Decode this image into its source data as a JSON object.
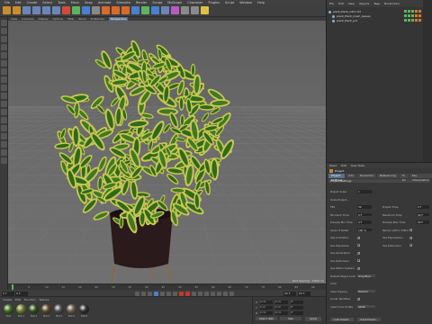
{
  "menubar": {
    "items": [
      "File",
      "Edit",
      "Create",
      "Select",
      "Tools",
      "Mesh",
      "Snap",
      "Animate",
      "Simulate",
      "Render",
      "Sculpt",
      "MoGraph",
      "Character",
      "Plugins",
      "Script",
      "Window",
      "Help"
    ]
  },
  "toolbar": {
    "icon_names": [
      "undo-icon",
      "redo-icon",
      "live-select-icon",
      "move-icon",
      "scale-icon",
      "rotate-icon",
      "x-axis-icon",
      "y-axis-icon",
      "z-axis-icon",
      "world-coord-icon",
      "render-view-icon",
      "render-picture-viewer-icon",
      "render-settings-icon",
      "cube-icon",
      "pen-icon",
      "subdivision-icon",
      "array-icon",
      "bend-icon",
      "floor-icon",
      "camera-icon",
      "light-icon"
    ]
  },
  "viewport": {
    "menu": [
      "View",
      "Cameras",
      "Display",
      "Options",
      "Filter",
      "Panel",
      "ProRender"
    ],
    "view_name": "Perspective",
    "grid_spacing": "Grid Spacing : 1000 cm",
    "background_color": "#666666"
  },
  "timeline": {
    "ticks": [
      "0",
      "5",
      "10",
      "15",
      "20",
      "25",
      "30",
      "35",
      "40",
      "45",
      "50",
      "55",
      "60",
      "65",
      "70",
      "75",
      "80",
      "85",
      "90"
    ],
    "current_frame": "0 F",
    "start": "0 F",
    "end": "90 F",
    "end_max": "90 F"
  },
  "material_manager": {
    "menu": [
      "Create",
      "Edit",
      "Function",
      "Texture"
    ],
    "materials": [
      "Mat",
      "Mat.1",
      "Mat.2",
      "Mat.3",
      "Mat.4",
      "Mat.5",
      "Mat.6"
    ],
    "colors": [
      "#3b6b1f",
      "#6f7a2c",
      "#2d4f1c",
      "#5c4a2a",
      "#4a4a4a",
      "#6b5b4a",
      "#2e2e2e"
    ]
  },
  "coordinates": {
    "rows": [
      {
        "axis": "X",
        "pos": "0 cm",
        "size": "0 cm",
        "rot": "0°"
      },
      {
        "axis": "Y",
        "pos": "0 cm",
        "size": "0 cm",
        "rot": "0°"
      },
      {
        "axis": "Z",
        "pos": "0 cm",
        "size": "0 cm",
        "rot": "0°"
      }
    ],
    "mode": "Object (Rel)",
    "size_mode": "Size",
    "apply": "Apply"
  },
  "object_manager": {
    "menu": [
      "File",
      "Edit",
      "View",
      "Objects",
      "Tags",
      "Bookmarks"
    ],
    "objects": [
      {
        "name": "plant_Plant_C4D.c4d"
      },
      {
        "name": "plant_Plant_mesh_leaves"
      },
      {
        "name": "plant_Plant_pot"
      }
    ]
  },
  "attributes": {
    "menu": [
      "Mode",
      "Edit",
      "User Data"
    ],
    "title": "Project",
    "tabs": [
      "Project Settings",
      "Info",
      "Dynamics",
      "Referencing",
      "To Do",
      "Key Interpolation"
    ],
    "active_tab": "Project Settings",
    "section": "Project Settings",
    "props": [
      {
        "label": "Project Scale",
        "value": "1"
      },
      {
        "label": "Scale Project...",
        "value": ""
      },
      {
        "label": "FPS",
        "value": "30"
      },
      {
        "label": "Minimum Time",
        "value": "0 F"
      },
      {
        "label": "Preview Min Time",
        "value": "0 F"
      },
      {
        "label": "Level of Detail",
        "value": "100 %"
      },
      {
        "label": "Use Animation",
        "value": ""
      },
      {
        "label": "Use Expression",
        "value": ""
      },
      {
        "label": "Use Generators",
        "value": ""
      },
      {
        "label": "Use Deformers",
        "value": ""
      },
      {
        "label": "Use Motion System",
        "value": ""
      },
      {
        "label": "Default Object Color",
        "value": "Gray-Blue"
      },
      {
        "label": "Color",
        "value": ""
      },
      {
        "label": "View Clipping",
        "value": "Medium"
      },
      {
        "label": "Linear Workflow",
        "value": ""
      },
      {
        "label": "Input Color Profile",
        "value": "sRGB"
      }
    ],
    "right_props": [
      {
        "label": "Project Time",
        "value": "0 F"
      },
      {
        "label": "Maximum Time",
        "value": "90 F"
      },
      {
        "label": "Preview Max Time",
        "value": "90 F"
      },
      {
        "label": "Render LOD in Editor",
        "value": ""
      },
      {
        "label": "Use Expressions",
        "value": ""
      },
      {
        "label": "Use Deformers",
        "value": ""
      }
    ],
    "buttons": [
      "Load Preset...",
      "Save Preset..."
    ]
  }
}
